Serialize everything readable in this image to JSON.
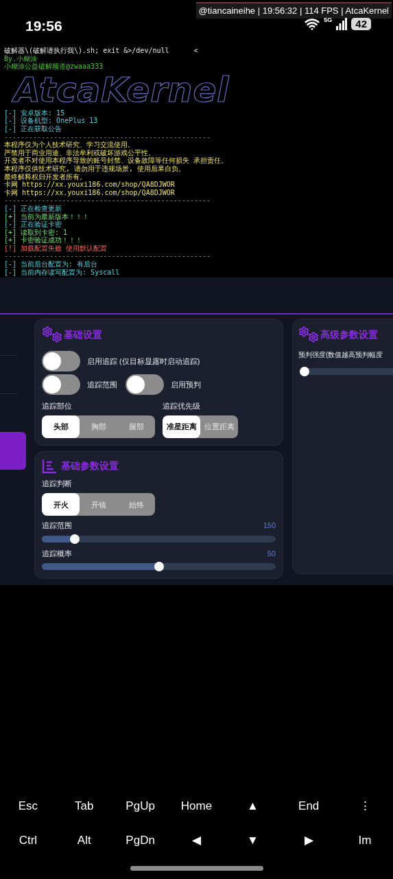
{
  "status_bar": {
    "time": "19:56",
    "overlay": "@tiancaineihe | 19:56:32 | 114 FPS | AtcaKernel",
    "network": "5G",
    "battery": "42"
  },
  "terminal": [
    {
      "kind": "command",
      "text": "破解器\\(破解请执行我\\).sh; exit &>/dev/null",
      "cursor": "<"
    },
    {
      "kind": "credit",
      "text": "By.小糊涂"
    },
    {
      "kind": "credit",
      "text": "小糊涂公益破解频道@zwaaa333"
    },
    {
      "kind": "logo",
      "text": "AtcaKernel"
    },
    {
      "kind": "info",
      "text": "[-] 安卓版本: 15"
    },
    {
      "kind": "info",
      "text": "[-] 设备机型: OnePlus 13"
    },
    {
      "kind": "info",
      "text": "[-] 正在获取公告"
    },
    {
      "kind": "divider",
      "text": "--------------------------------------------------"
    },
    {
      "kind": "notice",
      "text": "本程序仅为个人技术研究、学习交流使用。"
    },
    {
      "kind": "notice",
      "text": "严禁用于商业用途、非法牟利或破坏游戏公平性。"
    },
    {
      "kind": "notice",
      "text": "开发者不对使用本程序导致的账号封禁、设备故障等任何损失 承担责任。"
    },
    {
      "kind": "notice",
      "text": "本程序仅供技术研究, 请勿用于违规场景, 使用后果自负。"
    },
    {
      "kind": "notice",
      "text": "最终解释权归开发者所有。"
    },
    {
      "kind": "notice",
      "text": "卡网 https://xx.youxi186.com/shop/QA8DJWOR"
    },
    {
      "kind": "notice",
      "text": "卡网 https://xx.youxi186.com/shop/QA8DJWOR"
    },
    {
      "kind": "divider",
      "text": "--------------------------------------------------"
    },
    {
      "kind": "info",
      "text": "[-] 正在检查更新"
    },
    {
      "kind": "success",
      "text": "[+] 当前为最新版本！！！"
    },
    {
      "kind": "info",
      "text": "[-] 正在验证卡密"
    },
    {
      "kind": "success",
      "text": "[+] 读取到卡密: 1"
    },
    {
      "kind": "success",
      "text": "[+] 卡密验证成功！！！"
    },
    {
      "kind": "error",
      "text": "[!] 加载配置失败 使用默认配置"
    },
    {
      "kind": "divider",
      "text": "--------------------------------------------------"
    },
    {
      "kind": "info",
      "text": "[-] 当前后台配置为: 有后台"
    },
    {
      "kind": "info",
      "text": "[-] 当前内存读写配置为: Syscall"
    }
  ],
  "basic_settings": {
    "title": "基础设置",
    "toggle_rows": [
      [
        {
          "label": "启用追踪 (仅目标显露时启动追踪)",
          "on": false
        }
      ],
      [
        {
          "label": "追踪范围",
          "on": false
        },
        {
          "label": "启用预判",
          "on": false
        }
      ]
    ],
    "segment_groups": [
      {
        "label": "追踪部位",
        "options": [
          {
            "label": "头部",
            "selected": true
          },
          {
            "label": "胸部",
            "selected": false
          },
          {
            "label": "腿部",
            "selected": false
          }
        ]
      },
      {
        "label": "追踪优先级",
        "options": [
          {
            "label": "准星距离",
            "selected": true
          },
          {
            "label": "位置距离",
            "selected": false
          }
        ]
      }
    ]
  },
  "basic_params": {
    "title": "基础参数设置",
    "judgment": {
      "label": "追踪判断",
      "options": [
        {
          "label": "开火",
          "selected": true
        },
        {
          "label": "开镜",
          "selected": false
        },
        {
          "label": "始终",
          "selected": false
        }
      ]
    },
    "sliders": [
      {
        "label": "追踪范围",
        "reading": "150",
        "level": 0.125
      },
      {
        "label": "追踪概率",
        "reading": "50",
        "level": 0.5
      }
    ]
  },
  "advanced_params": {
    "title": "高级参数设置",
    "slider": {
      "label": "预判强度(数值越高预判幅度",
      "level": 0
    }
  },
  "keyboard": {
    "rows": [
      [
        "Esc",
        "Tab",
        "PgUp",
        "Home",
        "▲",
        "End",
        "⋮"
      ],
      [
        "Ctrl",
        "Alt",
        "PgDn",
        "◀",
        "▼",
        "▶",
        "Im"
      ]
    ]
  }
}
